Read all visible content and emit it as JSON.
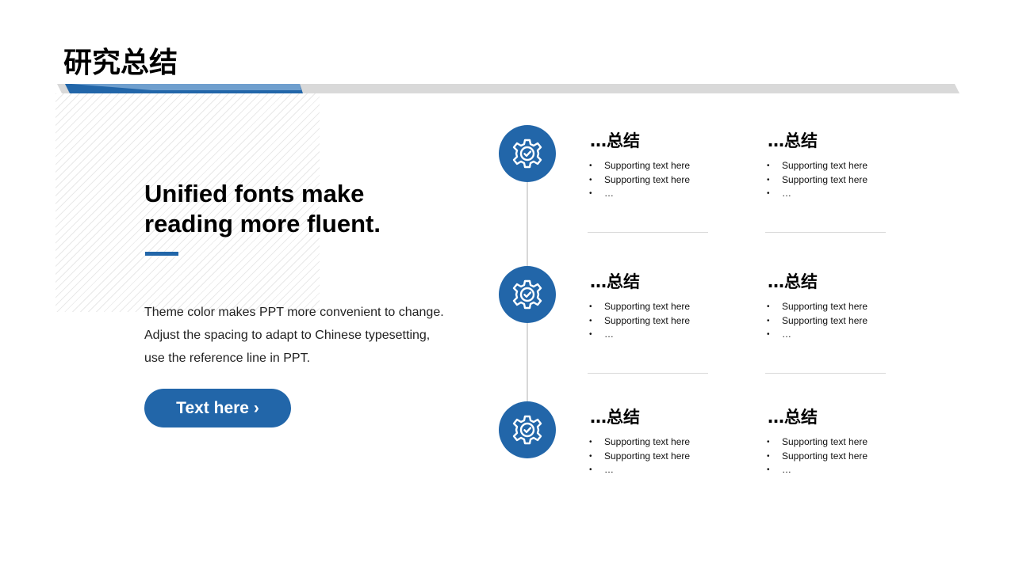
{
  "slide": {
    "title": "研究总结",
    "headline": [
      "Unified fonts make",
      "reading more fluent."
    ],
    "body": [
      "Theme color makes PPT more convenient to change.",
      "Adjust the spacing to adapt to Chinese typesetting,",
      "use the reference line in PPT."
    ],
    "button_label": "Text here ›"
  },
  "timeline": {
    "icon": "gear-check-icon",
    "cards": [
      {
        "title": "…总结",
        "items": [
          "Supporting text here",
          "Supporting text here",
          "…"
        ]
      },
      {
        "title": "…总结",
        "items": [
          "Supporting text here",
          "Supporting text here",
          "…"
        ]
      },
      {
        "title": "…总结",
        "items": [
          "Supporting text here",
          "Supporting text here",
          "…"
        ]
      },
      {
        "title": "…总结",
        "items": [
          "Supporting text here",
          "Supporting text here",
          "…"
        ]
      },
      {
        "title": "…总结",
        "items": [
          "Supporting text here",
          "Supporting text here",
          "…"
        ]
      },
      {
        "title": "…总结",
        "items": [
          "Supporting text here",
          "Supporting text here",
          "…"
        ]
      }
    ]
  },
  "colors": {
    "accent": "#2266a9",
    "accent_light": "#6f9fce",
    "bar_gray": "#d9d9d9",
    "divider": "#d9d9d9"
  }
}
